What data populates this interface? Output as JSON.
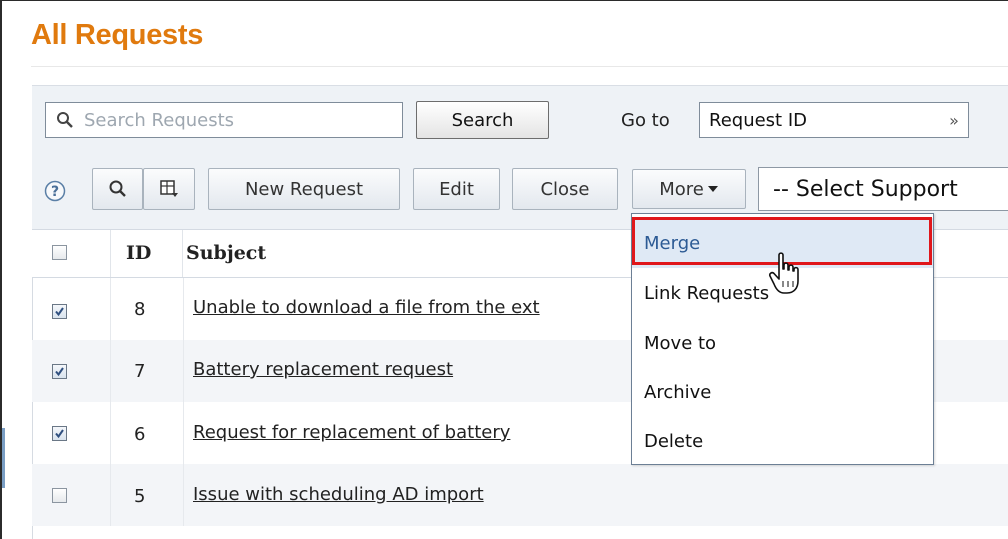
{
  "page": {
    "title": "All Requests"
  },
  "search": {
    "placeholder": "Search Requests",
    "button_label": "Search",
    "goto_label": "Go to",
    "goto_value": "Request ID",
    "goto_arrow": "»"
  },
  "toolbar": {
    "help_icon": "help-icon",
    "search_icon": "search-icon",
    "columns_icon": "columns-icon",
    "new_request_label": "New Request",
    "edit_label": "Edit",
    "close_label": "Close",
    "more_label": "More",
    "support_group_value": "-- Select Support"
  },
  "table": {
    "headers": {
      "id": "ID",
      "subject": "Subject"
    },
    "rows": [
      {
        "checked": true,
        "id": "8",
        "subject": "Unable to download a file from the ext"
      },
      {
        "checked": true,
        "id": "7",
        "subject": "Battery replacement request"
      },
      {
        "checked": true,
        "id": "6",
        "subject": "Request for replacement of battery"
      },
      {
        "checked": false,
        "id": "5",
        "subject": "Issue with scheduling AD import"
      }
    ]
  },
  "more_menu": {
    "items": [
      {
        "label": "Merge",
        "highlighted": true
      },
      {
        "label": "Link Requests",
        "highlighted": false
      },
      {
        "label": "Move to",
        "highlighted": false
      },
      {
        "label": "Archive",
        "highlighted": false
      },
      {
        "label": "Delete",
        "highlighted": false
      }
    ]
  },
  "colors": {
    "title": "#e07a0e",
    "highlight_border": "#e0171b",
    "menu_active_text": "#2c5a94"
  }
}
